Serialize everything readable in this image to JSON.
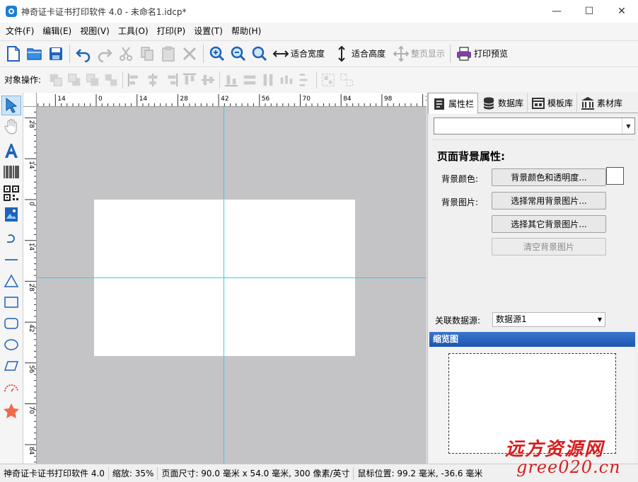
{
  "window": {
    "title": "神奇证卡证书打印软件 4.0 - 未命名1.idcp*",
    "minimize": "—",
    "maximize": "☐",
    "close": "✕"
  },
  "menu": [
    "文件(F)",
    "编辑(E)",
    "视图(V)",
    "工具(O)",
    "打印(P)",
    "设置(T)",
    "帮助(H)"
  ],
  "toolbar": {
    "fit_width": "适合宽度",
    "fit_height": "适合高度",
    "full_page": "整页显示",
    "print_preview": "打印预览"
  },
  "objbar": {
    "label": "对象操作:"
  },
  "ruler": {
    "top": [
      "14",
      "0",
      "14",
      "28",
      "42",
      "56",
      "70",
      "84",
      "98",
      "11"
    ],
    "left": [
      "28",
      "14",
      "0",
      "14",
      "28",
      "42",
      "56",
      "70",
      "84"
    ]
  },
  "panel": {
    "tabs": [
      "属性栏",
      "数据库",
      "模板库",
      "素材库"
    ],
    "prop_title": "页面背景属性:",
    "bg_color_label": "背景颜色:",
    "bg_color_btn": "背景颜色和透明度...",
    "bg_image_label": "背景图片:",
    "bg_common_btn": "选择常用背景图片...",
    "bg_other_btn": "选择其它背景图片...",
    "bg_clear_btn": "清空背景图片",
    "datasource_label": "关联数据源:",
    "datasource_value": "数据源1",
    "thumbnail_title": "缩览图"
  },
  "status": {
    "app": "神奇证卡证书打印软件 4.0",
    "zoom": "缩放: 35%",
    "page_size": "页面尺寸: 90.0 毫米 x 54.0 毫米, 300 像素/英寸",
    "mouse_pos": "鼠标位置: 99.2 毫米, -36.6 毫米"
  },
  "watermark": {
    "line1": "远方资源网",
    "line2": "gree020.cn"
  },
  "colors": {
    "guide": "#33d0e8",
    "canvas_bg": "#c4c4c6",
    "thumb_header": "#1c55b0",
    "watermark": "#d81e1e"
  }
}
